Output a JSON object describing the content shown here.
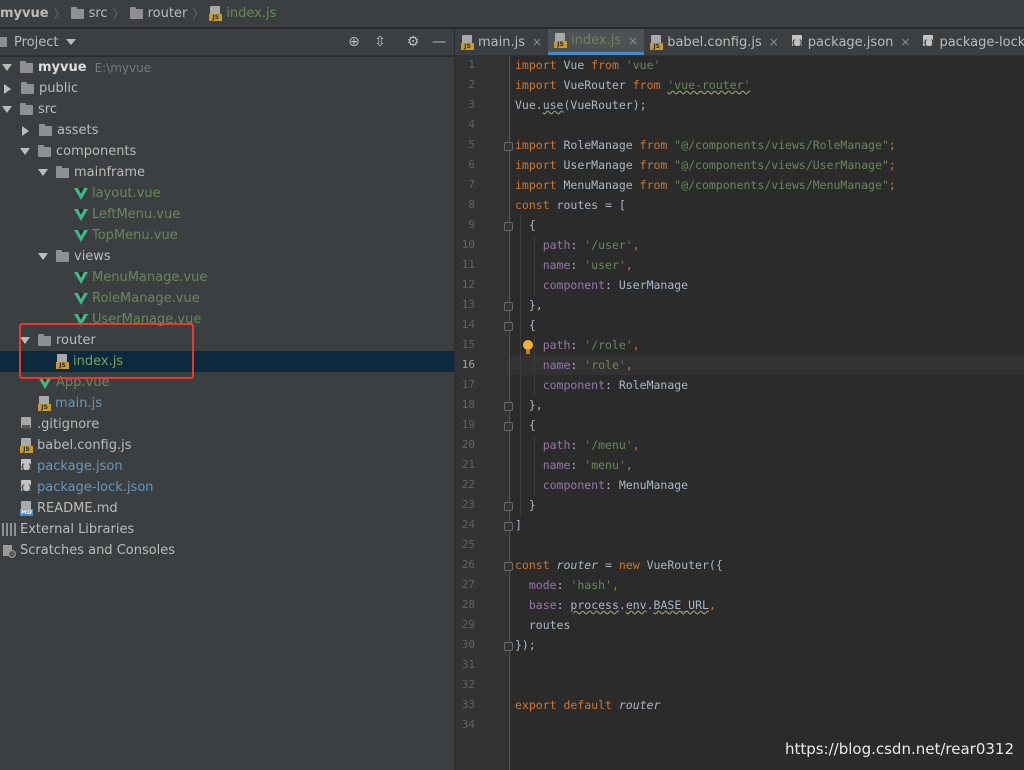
{
  "breadcrumb": [
    "myvue",
    "src",
    "router",
    "index.js"
  ],
  "project_panel": {
    "title": "Project",
    "tools": [
      "target-icon",
      "collapse-icon",
      "gear-icon",
      "minimize-icon"
    ],
    "tree": [
      {
        "label": "myvue",
        "path": "E:\\myvue"
      },
      {
        "label": "public"
      },
      {
        "label": "src"
      },
      {
        "label": "assets"
      },
      {
        "label": "components"
      },
      {
        "label": "mainframe"
      },
      {
        "label": "layout.vue"
      },
      {
        "label": "LeftMenu.vue"
      },
      {
        "label": "TopMenu.vue"
      },
      {
        "label": "views"
      },
      {
        "label": "MenuManage.vue"
      },
      {
        "label": "RoleManage.vue"
      },
      {
        "label": "UserManage.vue"
      },
      {
        "label": "router"
      },
      {
        "label": "index.js"
      },
      {
        "label": "App.vue"
      },
      {
        "label": "main.js"
      },
      {
        "label": ".gitignore"
      },
      {
        "label": "babel.config.js"
      },
      {
        "label": "package.json"
      },
      {
        "label": "package-lock.json"
      },
      {
        "label": "README.md"
      },
      {
        "label": "External Libraries"
      },
      {
        "label": "Scratches and Consoles"
      }
    ]
  },
  "tabs": [
    {
      "label": "main.js",
      "close": "×"
    },
    {
      "label": "index.js",
      "close": "×"
    },
    {
      "label": "babel.config.js",
      "close": "×"
    },
    {
      "label": "package.json",
      "close": "×"
    },
    {
      "label": "package-lock.json",
      "close": "×"
    }
  ],
  "editor": {
    "current_line": 16,
    "line_numbers": [
      "1",
      "2",
      "3",
      "4",
      "5",
      "6",
      "7",
      "8",
      "9",
      "10",
      "11",
      "12",
      "13",
      "14",
      "15",
      "16",
      "17",
      "18",
      "19",
      "20",
      "21",
      "22",
      "23",
      "24",
      "25",
      "26",
      "27",
      "28",
      "29",
      "30",
      "31",
      "32",
      "33",
      "34"
    ]
  },
  "code": {
    "l1": {
      "kw": "import",
      "id": " Vue ",
      "kw2": "from",
      "str": " 'vue'"
    },
    "l2": {
      "kw": "import",
      "id": " VueRouter ",
      "kw2": "from",
      "str": "'vue-router'"
    },
    "l3": {
      "a": "Vue.",
      "b": "use",
      "c": "(VueRouter);"
    },
    "l5": {
      "kw": "import",
      "id": " RoleManage ",
      "kw2": "from",
      "str": " \"@/components/views/RoleManage\"",
      "end": ";"
    },
    "l6": {
      "kw": "import",
      "id": " UserManage ",
      "kw2": "from",
      "str": " \"@/components/views/UserManage\"",
      "end": ";"
    },
    "l7": {
      "kw": "import",
      "id": " MenuManage ",
      "kw2": "from",
      "str": " \"@/components/views/MenuManage\"",
      "end": ";"
    },
    "l8": {
      "kw": "const",
      "rest": " routes = ["
    },
    "l9": "  {",
    "l10": {
      "prop": "path",
      "sep": ": ",
      "str": "'/user'",
      "end": ","
    },
    "l11": {
      "prop": "name",
      "sep": ": ",
      "str": "'user'",
      "end": ","
    },
    "l12": {
      "prop": "component",
      "sep": ": ",
      "val": "UserManage"
    },
    "l13": "  },",
    "l14": "  {",
    "l15": {
      "prop": "path",
      "sep": ": ",
      "str": "'/role'",
      "end": ","
    },
    "l16": {
      "prop": "name",
      "sep": ": ",
      "str": "'role'",
      "end": ","
    },
    "l17": {
      "prop": "component",
      "sep": ": ",
      "val": "RoleManage"
    },
    "l18": "  },",
    "l19": "  {",
    "l20": {
      "prop": "path",
      "sep": ": ",
      "str": "'/menu'",
      "end": ","
    },
    "l21": {
      "prop": "name",
      "sep": ": ",
      "str": "'menu'",
      "end": ","
    },
    "l22": {
      "prop": "component",
      "sep": ": ",
      "val": "MenuManage"
    },
    "l23": "  }",
    "l24": "]",
    "l26": {
      "kw": "const",
      "var": " router",
      "eq": " = ",
      "kw2": "new",
      "rest": " VueRouter({"
    },
    "l27": {
      "prop": "mode",
      "sep": ": ",
      "str": "'hash'",
      "end": ","
    },
    "l28": {
      "prop": "base",
      "sep": ": ",
      "a": "process",
      "b": ".",
      "c": "env",
      "d": ".",
      "e": "BASE_URL",
      "end": ","
    },
    "l29": {
      "val": "routes"
    },
    "l30": "});",
    "l33": {
      "kw": "export",
      "kw2": " default ",
      "var": "router"
    }
  },
  "watermark": "https://blog.csdn.net/rear0312"
}
